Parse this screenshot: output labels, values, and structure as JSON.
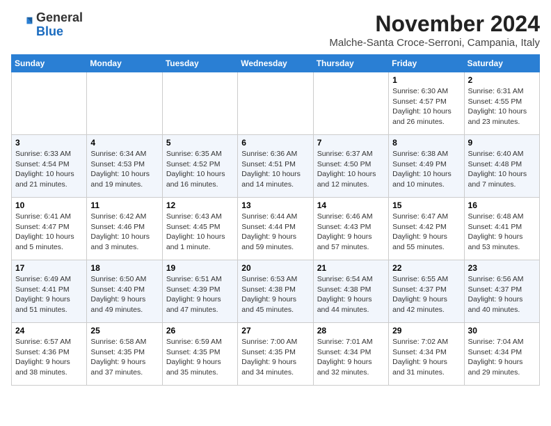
{
  "logo": {
    "general": "General",
    "blue": "Blue"
  },
  "title": "November 2024",
  "subtitle": "Malche-Santa Croce-Serroni, Campania, Italy",
  "days_of_week": [
    "Sunday",
    "Monday",
    "Tuesday",
    "Wednesday",
    "Thursday",
    "Friday",
    "Saturday"
  ],
  "weeks": [
    [
      {
        "day": "",
        "info": ""
      },
      {
        "day": "",
        "info": ""
      },
      {
        "day": "",
        "info": ""
      },
      {
        "day": "",
        "info": ""
      },
      {
        "day": "",
        "info": ""
      },
      {
        "day": "1",
        "info": "Sunrise: 6:30 AM\nSunset: 4:57 PM\nDaylight: 10 hours and 26 minutes."
      },
      {
        "day": "2",
        "info": "Sunrise: 6:31 AM\nSunset: 4:55 PM\nDaylight: 10 hours and 23 minutes."
      }
    ],
    [
      {
        "day": "3",
        "info": "Sunrise: 6:33 AM\nSunset: 4:54 PM\nDaylight: 10 hours and 21 minutes."
      },
      {
        "day": "4",
        "info": "Sunrise: 6:34 AM\nSunset: 4:53 PM\nDaylight: 10 hours and 19 minutes."
      },
      {
        "day": "5",
        "info": "Sunrise: 6:35 AM\nSunset: 4:52 PM\nDaylight: 10 hours and 16 minutes."
      },
      {
        "day": "6",
        "info": "Sunrise: 6:36 AM\nSunset: 4:51 PM\nDaylight: 10 hours and 14 minutes."
      },
      {
        "day": "7",
        "info": "Sunrise: 6:37 AM\nSunset: 4:50 PM\nDaylight: 10 hours and 12 minutes."
      },
      {
        "day": "8",
        "info": "Sunrise: 6:38 AM\nSunset: 4:49 PM\nDaylight: 10 hours and 10 minutes."
      },
      {
        "day": "9",
        "info": "Sunrise: 6:40 AM\nSunset: 4:48 PM\nDaylight: 10 hours and 7 minutes."
      }
    ],
    [
      {
        "day": "10",
        "info": "Sunrise: 6:41 AM\nSunset: 4:47 PM\nDaylight: 10 hours and 5 minutes."
      },
      {
        "day": "11",
        "info": "Sunrise: 6:42 AM\nSunset: 4:46 PM\nDaylight: 10 hours and 3 minutes."
      },
      {
        "day": "12",
        "info": "Sunrise: 6:43 AM\nSunset: 4:45 PM\nDaylight: 10 hours and 1 minute."
      },
      {
        "day": "13",
        "info": "Sunrise: 6:44 AM\nSunset: 4:44 PM\nDaylight: 9 hours and 59 minutes."
      },
      {
        "day": "14",
        "info": "Sunrise: 6:46 AM\nSunset: 4:43 PM\nDaylight: 9 hours and 57 minutes."
      },
      {
        "day": "15",
        "info": "Sunrise: 6:47 AM\nSunset: 4:42 PM\nDaylight: 9 hours and 55 minutes."
      },
      {
        "day": "16",
        "info": "Sunrise: 6:48 AM\nSunset: 4:41 PM\nDaylight: 9 hours and 53 minutes."
      }
    ],
    [
      {
        "day": "17",
        "info": "Sunrise: 6:49 AM\nSunset: 4:41 PM\nDaylight: 9 hours and 51 minutes."
      },
      {
        "day": "18",
        "info": "Sunrise: 6:50 AM\nSunset: 4:40 PM\nDaylight: 9 hours and 49 minutes."
      },
      {
        "day": "19",
        "info": "Sunrise: 6:51 AM\nSunset: 4:39 PM\nDaylight: 9 hours and 47 minutes."
      },
      {
        "day": "20",
        "info": "Sunrise: 6:53 AM\nSunset: 4:38 PM\nDaylight: 9 hours and 45 minutes."
      },
      {
        "day": "21",
        "info": "Sunrise: 6:54 AM\nSunset: 4:38 PM\nDaylight: 9 hours and 44 minutes."
      },
      {
        "day": "22",
        "info": "Sunrise: 6:55 AM\nSunset: 4:37 PM\nDaylight: 9 hours and 42 minutes."
      },
      {
        "day": "23",
        "info": "Sunrise: 6:56 AM\nSunset: 4:37 PM\nDaylight: 9 hours and 40 minutes."
      }
    ],
    [
      {
        "day": "24",
        "info": "Sunrise: 6:57 AM\nSunset: 4:36 PM\nDaylight: 9 hours and 38 minutes."
      },
      {
        "day": "25",
        "info": "Sunrise: 6:58 AM\nSunset: 4:35 PM\nDaylight: 9 hours and 37 minutes."
      },
      {
        "day": "26",
        "info": "Sunrise: 6:59 AM\nSunset: 4:35 PM\nDaylight: 9 hours and 35 minutes."
      },
      {
        "day": "27",
        "info": "Sunrise: 7:00 AM\nSunset: 4:35 PM\nDaylight: 9 hours and 34 minutes."
      },
      {
        "day": "28",
        "info": "Sunrise: 7:01 AM\nSunset: 4:34 PM\nDaylight: 9 hours and 32 minutes."
      },
      {
        "day": "29",
        "info": "Sunrise: 7:02 AM\nSunset: 4:34 PM\nDaylight: 9 hours and 31 minutes."
      },
      {
        "day": "30",
        "info": "Sunrise: 7:04 AM\nSunset: 4:34 PM\nDaylight: 9 hours and 29 minutes."
      }
    ]
  ],
  "colors": {
    "header_bg": "#2a7fd4",
    "header_text": "#ffffff",
    "row_even": "#f2f6fc",
    "row_odd": "#ffffff"
  }
}
